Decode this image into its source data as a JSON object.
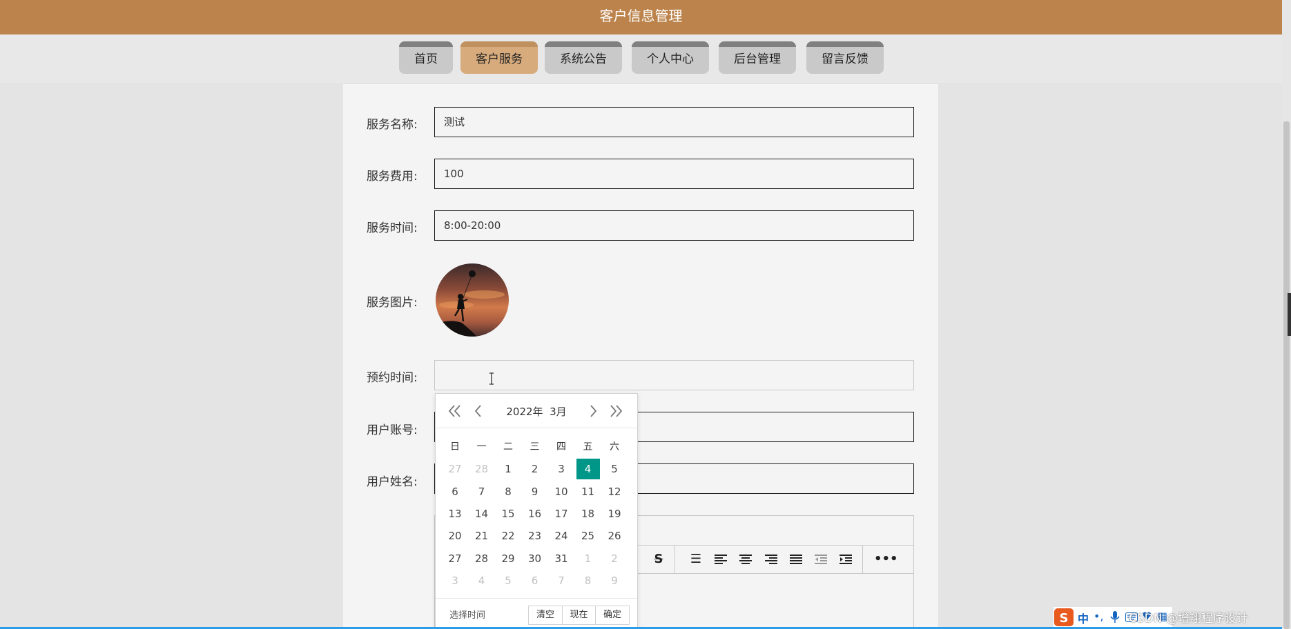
{
  "header": {
    "title": "客户信息管理"
  },
  "nav": {
    "tabs": [
      {
        "label": "首页"
      },
      {
        "label": "客户服务"
      },
      {
        "label": "系统公告"
      },
      {
        "label": "个人中心"
      },
      {
        "label": "后台管理"
      },
      {
        "label": "留言反馈"
      }
    ],
    "active_index": 1
  },
  "form": {
    "service_name": {
      "label": "服务名称:",
      "value": "测试"
    },
    "service_fee": {
      "label": "服务费用:",
      "value": "100"
    },
    "service_time": {
      "label": "服务时间:",
      "value": "8:00-20:00"
    },
    "service_image": {
      "label": "服务图片:"
    },
    "booking_time": {
      "label": "预约时间:",
      "value": ""
    },
    "user_account": {
      "label": "用户账号:",
      "value": ""
    },
    "user_name": {
      "label": "用户姓名:",
      "value": ""
    }
  },
  "datepicker": {
    "year_label": "2022年",
    "month_label": "3月",
    "weekdays": [
      "日",
      "一",
      "二",
      "三",
      "四",
      "五",
      "六"
    ],
    "weeks": [
      [
        "27",
        "28",
        "1",
        "2",
        "3",
        "4",
        "5"
      ],
      [
        "6",
        "7",
        "8",
        "9",
        "10",
        "11",
        "12"
      ],
      [
        "13",
        "14",
        "15",
        "16",
        "17",
        "18",
        "19"
      ],
      [
        "20",
        "21",
        "22",
        "23",
        "24",
        "25",
        "26"
      ],
      [
        "27",
        "28",
        "29",
        "30",
        "31",
        "1",
        "2"
      ],
      [
        "3",
        "4",
        "5",
        "6",
        "7",
        "8",
        "9"
      ]
    ],
    "selected_day": "4",
    "select_time_label": "选择时间",
    "clear_label": "清空",
    "now_label": "现在",
    "confirm_label": "确定",
    "selected_color": "#009688"
  },
  "editor_toolbar": {
    "icons": [
      "strikethrough-icon",
      "line-height-icon",
      "align-left-icon",
      "align-center-icon",
      "align-right-icon",
      "justify-icon",
      "indent-decrease-icon",
      "indent-increase-icon",
      "more-icon"
    ]
  },
  "taskbar": {
    "ime_label": "中",
    "watermark": "CSDN @增翔程序设计"
  },
  "colors": {
    "header": "#bc844c",
    "tab_active": "#d8ab7c",
    "tab_inactive": "#c9c9c9"
  }
}
